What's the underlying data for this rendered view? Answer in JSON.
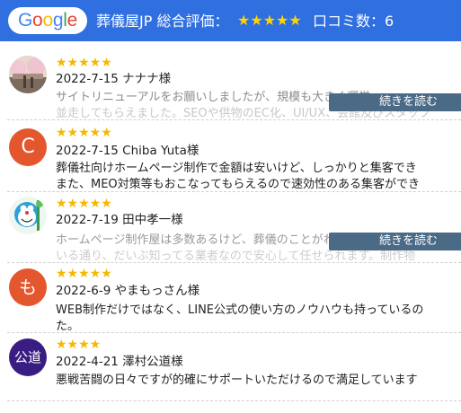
{
  "header": {
    "logo_letters": [
      "G",
      "o",
      "o",
      "g",
      "l",
      "e"
    ],
    "logo_colors": [
      "#4285F4",
      "#EA4335",
      "#FBBC05",
      "#4285F4",
      "#34A853",
      "#EA4335"
    ],
    "title": "葬儀屋JP 総合評価：",
    "stars": "★★★★★",
    "review_count": "口コミ数：6"
  },
  "reviews": [
    {
      "stars": "★★★★★",
      "date_name": "2022-7-15 ナナナ様",
      "lines": [
        "サイトリニューアルをお願いしましたが、規模も大きく運営",
        "並走してもらえました。SEOや供物のEC化、UI/UX、会館及びスタッフ"
      ],
      "avatar_icon": "photo-avatar"
    },
    {
      "stars": "★★★★★",
      "date_name": "2022-7-15 Chiba Yuta様",
      "lines": [
        "葬儀社向けホームページ制作で金額は安いけど、しっかりと集客でき",
        "また、MEO対策等もおこなってもらえるので速効性のある集客ができ"
      ],
      "avatar_text": "C",
      "avatar_color": "#e4572e"
    },
    {
      "stars": "★★★★★",
      "date_name": "2022-7-19 田中孝一様",
      "lines": [
        "ホームページ制作屋は多数あるけど、葬儀のことがわかっている業者",
        "いる通り、だいぶ知ってる業者なので安心して任せられます。制作物"
      ],
      "avatar_icon": "cartoon-avatar"
    },
    {
      "stars": "★★★★★",
      "date_name": "2022-6-9 やまもっさん様",
      "lines": [
        "WEB制作だけではなく、LINE公式の使い方のノウハウも持っているの",
        "た。"
      ],
      "avatar_text": "も",
      "avatar_color": "#e4572e"
    },
    {
      "stars": "★★★★",
      "date_name": "2022-4-21 澤村公道様",
      "lines": [
        "悪戦苦闘の日々ですが的確にサポートいただけるので満足しています"
      ],
      "avatar_text": "公道",
      "avatar_color": "#3a1d83"
    }
  ],
  "more_button_label": "続きを読む"
}
